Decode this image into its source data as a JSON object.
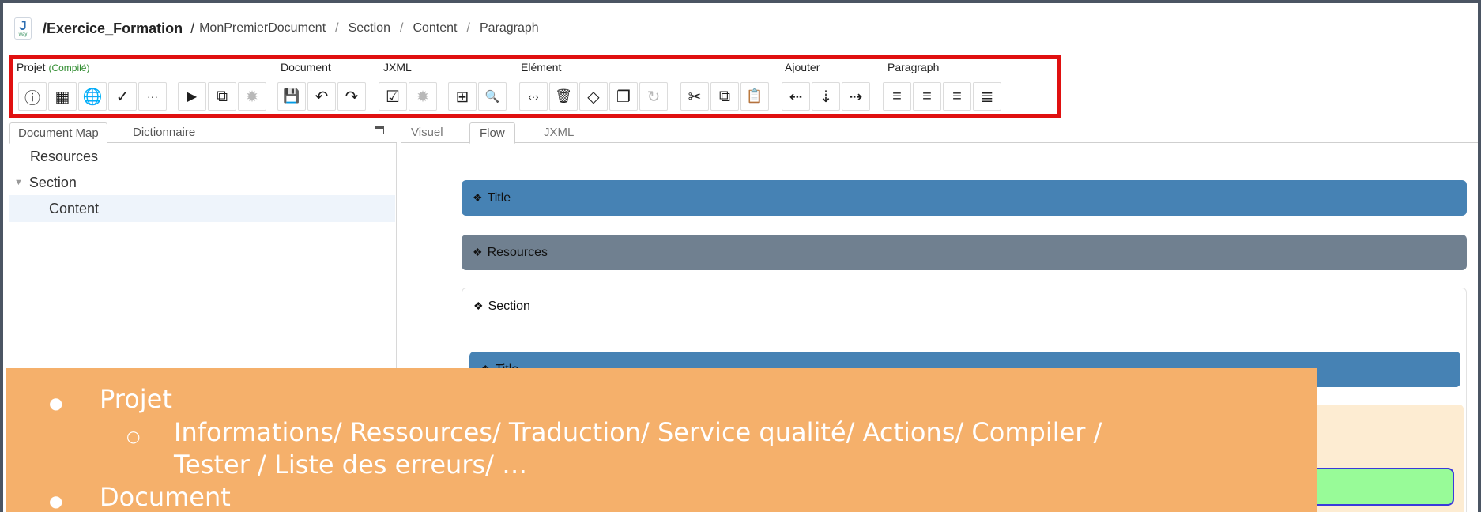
{
  "breadcrumb": {
    "logo_letter": "J",
    "logo_sub": "way",
    "project": "/Exercice_Formation",
    "slash": "/",
    "items": [
      "MonPremierDocument",
      "Section",
      "Content",
      "Paragraph"
    ],
    "sep": "/"
  },
  "toolbar": {
    "groups": {
      "projet": "Projet",
      "projet_status": "(Compilé)",
      "document": "Document",
      "jxml": "JXML",
      "element": "Elément",
      "ajouter": "Ajouter",
      "paragraph": "Paragraph"
    },
    "buttons": [
      {
        "icon": "info-icon",
        "glyph": "ⓘ"
      },
      {
        "icon": "resources-icon",
        "glyph": "▦"
      },
      {
        "icon": "globe-icon",
        "glyph": "🌐"
      },
      {
        "icon": "check-icon",
        "glyph": "✓"
      },
      {
        "icon": "more-icon",
        "glyph": "···"
      },
      {
        "icon": "play-icon",
        "glyph": "▶"
      },
      {
        "icon": "external-link-icon",
        "glyph": "⧉"
      },
      {
        "icon": "bug-icon",
        "glyph": "✹"
      },
      {
        "icon": "save-icon",
        "glyph": "💾"
      },
      {
        "icon": "undo-icon",
        "glyph": "↶"
      },
      {
        "icon": "redo-icon",
        "glyph": "↷"
      },
      {
        "icon": "validate-icon",
        "glyph": "☑"
      },
      {
        "icon": "jxml-settings-icon",
        "glyph": "✹"
      },
      {
        "icon": "add-box-icon",
        "glyph": "⊞"
      },
      {
        "icon": "search-icon",
        "glyph": "🔍"
      },
      {
        "icon": "code-icon",
        "glyph": "‹·›"
      },
      {
        "icon": "trash-icon",
        "glyph": "🗑"
      },
      {
        "icon": "target-icon",
        "glyph": "◇"
      },
      {
        "icon": "copy-element-icon",
        "glyph": "❐"
      },
      {
        "icon": "refresh-icon",
        "glyph": "↻"
      },
      {
        "icon": "scissors-icon",
        "glyph": "✂"
      },
      {
        "icon": "copy-icon",
        "glyph": "⧉"
      },
      {
        "icon": "paste-icon",
        "glyph": "📋"
      },
      {
        "icon": "insert-before-icon",
        "glyph": "⇠"
      },
      {
        "icon": "insert-inside-icon",
        "glyph": "⇣"
      },
      {
        "icon": "insert-after-icon",
        "glyph": "⇢"
      },
      {
        "icon": "align-left-icon",
        "glyph": "≡"
      },
      {
        "icon": "align-center-icon",
        "glyph": "≡"
      },
      {
        "icon": "align-right-icon",
        "glyph": "≡"
      },
      {
        "icon": "align-justify-icon",
        "glyph": "≣"
      }
    ]
  },
  "left": {
    "tabs": [
      "Document Map",
      "Dictionnaire"
    ],
    "tree": [
      "Resources",
      "Section",
      "Content"
    ]
  },
  "right": {
    "tabs": [
      "Visuel",
      "Flow",
      "JXML"
    ],
    "blocks": {
      "title": "Title",
      "resources": "Resources",
      "section": "Section",
      "title2": "Title"
    },
    "colors": {
      "title": "#4682b4",
      "resources": "#708090",
      "green": "#98fb98"
    }
  },
  "overlay": {
    "l1": "Projet",
    "l2": "Informations/ Ressources/ Traduction/ Service qualité/ Actions/ Compiler /",
    "l3": "Tester / Liste des erreurs/ …",
    "l4": "Document"
  }
}
